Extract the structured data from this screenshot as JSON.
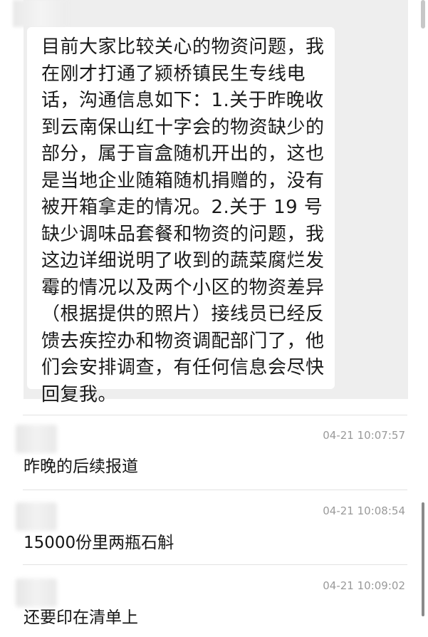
{
  "quoted_message": {
    "lines": [
      "目前大家比较关心的物资问题，我",
      "在刚才打通了颍桥镇民生专线电",
      "话，沟通信息如下：1.关于昨晚收",
      "到云南保山红十字会的物资缺少的",
      "部分，属于盲盒随机开出的，这也",
      "是当地企业随箱随机捐赠的，没有",
      "被开箱拿走的情况。2.关于 19 号",
      "缺少调味品套餐和物资的问题，我",
      "这边详细说明了收到的蔬菜腐烂发",
      "霉的情况以及两个小区的物资差异",
      "（根据提供的照片）接线员已经反",
      "馈去疾控办和物资调配部门了，他",
      "们会安排调查，有任何信息会尽快",
      "回复我。"
    ]
  },
  "messages": [
    {
      "timestamp": "04-21 10:07:57",
      "text": "昨晚的后续报道"
    },
    {
      "timestamp": "04-21 10:08:54",
      "text": "15000份里两瓶石斛"
    },
    {
      "timestamp": "04-21 10:09:02",
      "text": "还要印在清单上"
    }
  ]
}
